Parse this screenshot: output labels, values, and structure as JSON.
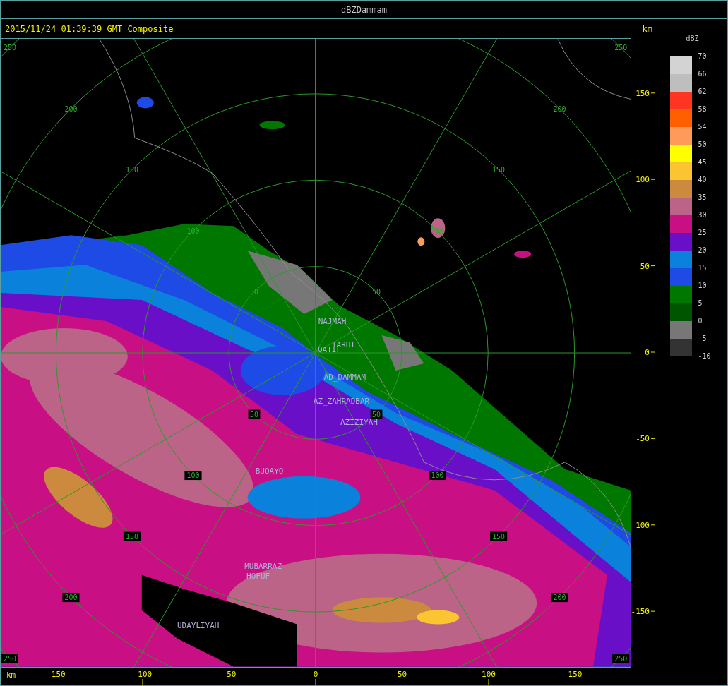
{
  "window": {
    "title": "dBZDammam"
  },
  "header": {
    "timestamp": "2015/11/24 01:39:39 GMT Composite"
  },
  "map": {
    "range_rings": [
      {
        "labels": [
          "50",
          "50",
          "50",
          "50"
        ]
      },
      {
        "labels": [
          "100",
          "100",
          "100",
          "100"
        ]
      },
      {
        "labels": [
          "150",
          "150",
          "150",
          "150"
        ]
      },
      {
        "labels": [
          "200",
          "200",
          "200",
          "200"
        ]
      },
      {
        "labels": [
          "250",
          "250",
          "250",
          "250"
        ]
      }
    ],
    "places": [
      "NAJMAH",
      "TARUT",
      "QATIF",
      "AD_DAMMAM",
      "AZ_ZAHRADBAR",
      "AZIZIYAH",
      "BUQAYQ",
      "MUBARRAZ",
      "HOFUF",
      "UDAYLIYAH"
    ]
  },
  "x_axis": {
    "unit": "km",
    "ticks": [
      "-150",
      "-100",
      "-50",
      "0",
      "50",
      "100",
      "150"
    ]
  },
  "y_axis": {
    "unit": "km",
    "ticks": [
      "150",
      "100",
      "50",
      "0",
      "-50",
      "-100",
      "-150"
    ]
  },
  "legend": {
    "title": "dBZ",
    "bands": [
      {
        "label": "70",
        "color": "#d3d3d3"
      },
      {
        "label": "66",
        "color": "#bebebe"
      },
      {
        "label": "62",
        "color": "#ff3522"
      },
      {
        "label": "58",
        "color": "#ff5f00"
      },
      {
        "label": "54",
        "color": "#ff9a5a"
      },
      {
        "label": "50",
        "color": "#ffff00"
      },
      {
        "label": "45",
        "color": "#fbc531"
      },
      {
        "label": "40",
        "color": "#cc8a3f"
      },
      {
        "label": "35",
        "color": "#bc6487"
      },
      {
        "label": "30",
        "color": "#c80f83"
      },
      {
        "label": "25",
        "color": "#6a0fc8"
      },
      {
        "label": "20",
        "color": "#0a82dc"
      },
      {
        "label": "15",
        "color": "#1e4ae6"
      },
      {
        "label": "10",
        "color": "#007800"
      },
      {
        "label": "5",
        "color": "#005500"
      },
      {
        "label": "0",
        "color": "#777777"
      },
      {
        "label": "-5",
        "color": "#333333"
      }
    ],
    "bottom_label": "-10"
  }
}
